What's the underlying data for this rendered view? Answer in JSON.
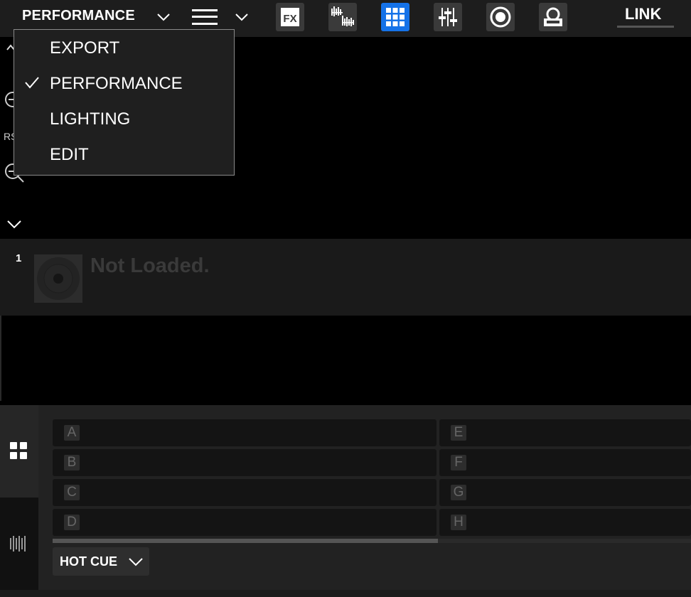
{
  "topbar": {
    "mode_label": "PERFORMANCE",
    "link_label": "LINK",
    "tools": [
      {
        "name": "fx",
        "icon": "fx-icon",
        "text": "FX"
      },
      {
        "name": "waveform",
        "icon": "waveform-split-icon"
      },
      {
        "name": "pad-grid",
        "icon": "pad-grid-icon",
        "active": true
      },
      {
        "name": "mixer",
        "icon": "mixer-sliders-icon"
      },
      {
        "name": "record",
        "icon": "record-icon"
      },
      {
        "name": "sampler-deck",
        "icon": "turntable-icon"
      }
    ]
  },
  "menu": {
    "items": [
      {
        "label": "EXPORT",
        "checked": false
      },
      {
        "label": "PERFORMANCE",
        "checked": true
      },
      {
        "label": "LIGHTING",
        "checked": false
      },
      {
        "label": "EDIT",
        "checked": false
      }
    ]
  },
  "left_panel": {
    "partial_text": "RS"
  },
  "deck": {
    "number": "1",
    "status": "Not Loaded."
  },
  "pads": {
    "left": [
      "A",
      "B",
      "C",
      "D"
    ],
    "right": [
      "E",
      "F",
      "G",
      "H"
    ],
    "mode_label": "HOT CUE"
  },
  "colors": {
    "accent": "#1572e8",
    "background": "#000000",
    "panel": "#1d1d1d"
  }
}
